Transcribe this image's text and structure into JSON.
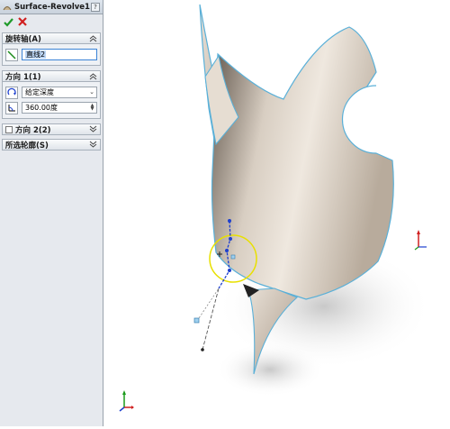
{
  "feature": {
    "title": "Surface-Revolve1",
    "help_label": "?"
  },
  "sections": {
    "axis": {
      "title": "旋转轴(A)",
      "value": "直线2"
    },
    "direction1": {
      "title": "方向 1(1)",
      "end_condition": "给定深度",
      "angle": "360.00度"
    },
    "direction2": {
      "title": "方向 2(2)"
    },
    "selected_contours": {
      "title": "所选轮廓(S)"
    }
  },
  "colors": {
    "panel_bg": "#e6e9ee",
    "part_surface": "#c9bfb3",
    "edge": "#5ab0d8",
    "selection": "#e8e000",
    "accent_blue": "#1d3fcf"
  }
}
